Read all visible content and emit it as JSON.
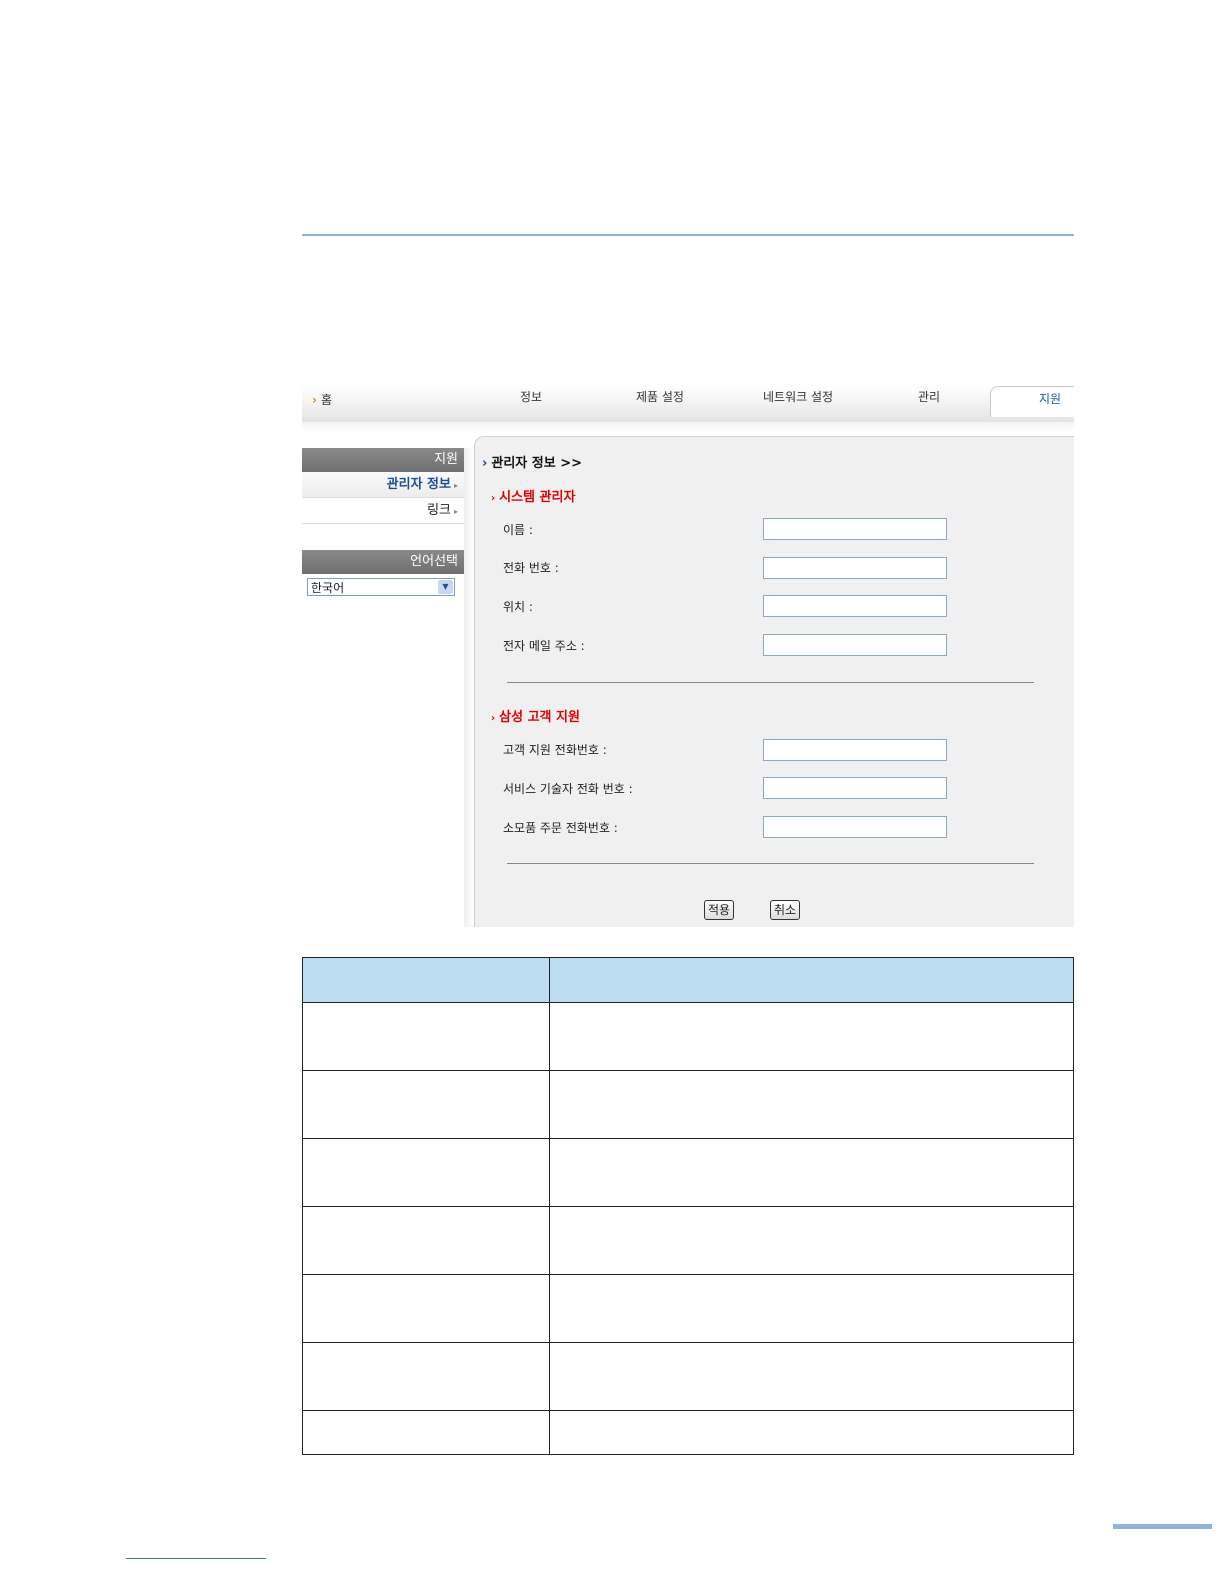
{
  "nav": {
    "home": "홈",
    "tabs": [
      "정보",
      "제품 설정",
      "네트워크 설정",
      "관리"
    ],
    "active_tab": "지원"
  },
  "sidebar": {
    "header": "지원",
    "items": [
      {
        "label": "관리자 정보",
        "active": true
      },
      {
        "label": "링크",
        "active": false
      }
    ],
    "language_header": "언어선택",
    "language_value": "한국어"
  },
  "content": {
    "title": "관리자 정보 >>",
    "section1": {
      "title": "시스템 관리자",
      "fields": [
        "이름 :",
        "전화 번호 :",
        "위치 :",
        "전자 메일 주소 :"
      ]
    },
    "section2": {
      "title": "삼성 고객 지원",
      "fields": [
        "고객 지원 전화번호 :",
        "서비스 기술자 전화 번호 :",
        "소모품 주문 전화번호 :"
      ]
    },
    "apply_label": "적용",
    "cancel_label": "취소"
  },
  "table": {
    "header": [
      "",
      ""
    ],
    "rows": [
      [
        "",
        ""
      ],
      [
        "",
        ""
      ],
      [
        "",
        ""
      ],
      [
        "",
        ""
      ],
      [
        "",
        ""
      ],
      [
        "",
        ""
      ],
      [
        "",
        ""
      ]
    ]
  }
}
